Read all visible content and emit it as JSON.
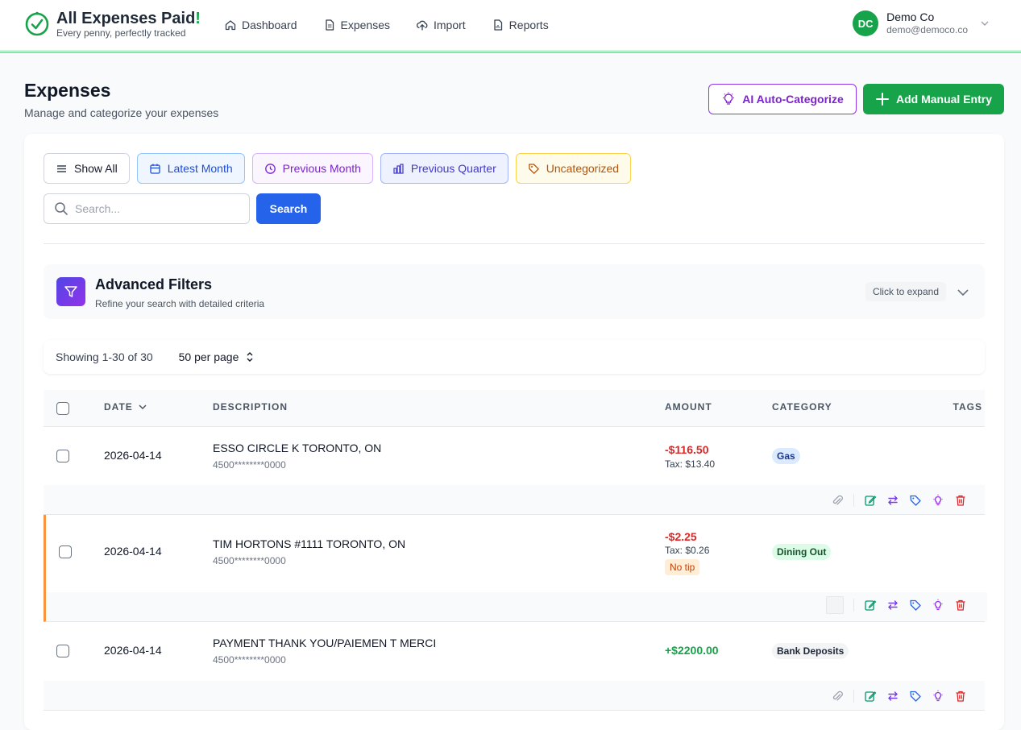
{
  "brand": {
    "title": "All Expenses Paid",
    "title_excl": "!",
    "subtitle": "Every penny, perfectly tracked"
  },
  "nav": [
    {
      "label": "Dashboard",
      "icon": "home-icon"
    },
    {
      "label": "Expenses",
      "icon": "document-icon"
    },
    {
      "label": "Import",
      "icon": "cloud-upload-icon"
    },
    {
      "label": "Reports",
      "icon": "report-icon"
    }
  ],
  "user": {
    "initials": "DC",
    "name": "Demo Co",
    "email": "demo@democo.co"
  },
  "page": {
    "title": "Expenses",
    "subtitle": "Manage and categorize your expenses"
  },
  "actions": {
    "ai_label": "AI Auto-Categorize",
    "add_label": "Add Manual Entry"
  },
  "quick_filters": [
    {
      "label": "Show All",
      "icon": "list-icon"
    },
    {
      "label": "Latest Month",
      "icon": "calendar-icon"
    },
    {
      "label": "Previous Month",
      "icon": "clock-icon"
    },
    {
      "label": "Previous Quarter",
      "icon": "bar-chart-icon"
    },
    {
      "label": "Uncategorized",
      "icon": "tag-icon"
    }
  ],
  "search": {
    "placeholder": "Search...",
    "value": "",
    "button_label": "Search"
  },
  "advanced_filters": {
    "title": "Advanced Filters",
    "subtitle": "Refine your search with detailed criteria",
    "hint": "Click to expand"
  },
  "pagination": {
    "showing": "Showing 1-30 of 30",
    "per_page": "50 per page"
  },
  "table": {
    "headers": {
      "date": "DATE",
      "description": "DESCRIPTION",
      "amount": "AMOUNT",
      "category": "CATEGORY",
      "tags": "TAGS"
    },
    "rows": [
      {
        "date": "2026-04-14",
        "description": "ESSO CIRCLE K TORONTO, ON",
        "card": "4500********0000",
        "amount": "-$116.50",
        "tax": "Tax: $13.40",
        "category": "Gas"
      },
      {
        "date": "2026-04-14",
        "description": "TIM HORTONS #1111 TORONTO, ON",
        "card": "4500********0000",
        "amount": "-$2.25",
        "tax": "Tax: $0.26",
        "flag": "No tip",
        "category": "Dining Out"
      },
      {
        "date": "2026-04-14",
        "description": "PAYMENT THANK YOU/PAIEMEN T MERCI",
        "card": "4500********0000",
        "amount": "+$2200.00",
        "category": "Bank Deposits"
      }
    ]
  },
  "colors": {
    "brand_green": "#16a34a",
    "ai_purple": "#7e22ce",
    "search_blue": "#2563eb",
    "negative": "#dc2626",
    "positive": "#16a34a",
    "flag_orange": "#fb923c"
  }
}
